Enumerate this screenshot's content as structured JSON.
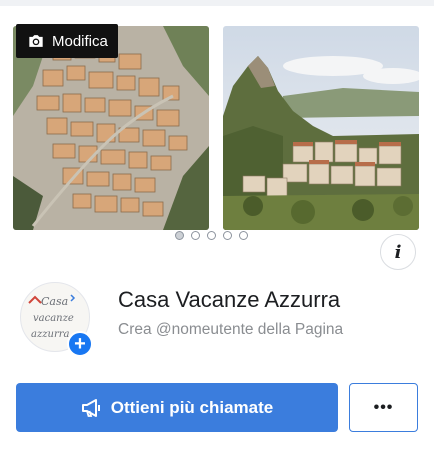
{
  "cover": {
    "edit_label": "Modifica",
    "edit_icon": "camera-icon",
    "photos": [
      "aerial-village-photo",
      "hilltop-town-photo"
    ],
    "carousel_dots": 5,
    "active_dot": 0
  },
  "info_button": {
    "label": "i",
    "icon": "info-icon"
  },
  "profile": {
    "avatar_text": [
      "Casa",
      "vacanze",
      "azzurra"
    ],
    "add_icon": "plus-icon",
    "page_name": "Casa Vacanze Azzurra",
    "username_prompt": "Crea @nomeutente della Pagina"
  },
  "actions": {
    "primary_label": "Ottieni più chiamate",
    "primary_icon": "megaphone-icon",
    "more_label": "•••"
  },
  "colors": {
    "accent": "#3b7ddd",
    "add_badge": "#1877f2"
  }
}
